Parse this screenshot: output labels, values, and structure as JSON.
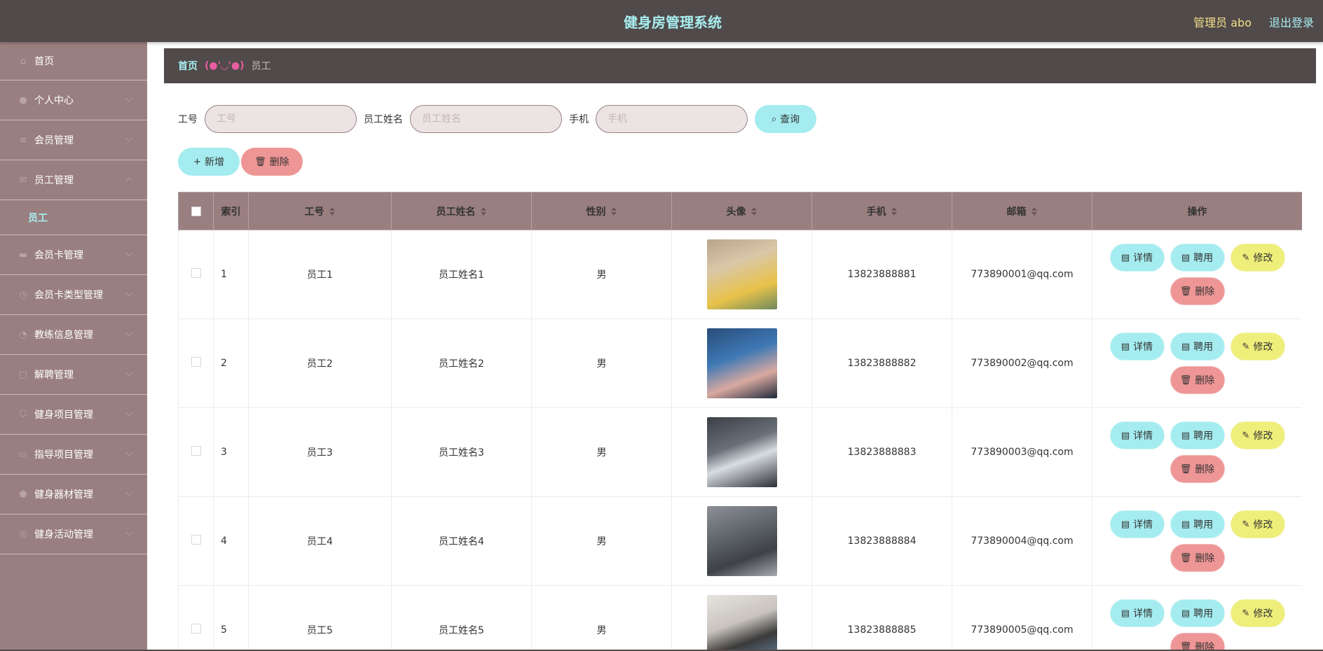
{
  "header": {
    "title": "健身房管理系统",
    "user_label": "管理员 abo",
    "logout_label": "退出登录"
  },
  "sidebar": {
    "items": [
      {
        "label": "首页",
        "icon": "home-icon"
      },
      {
        "label": "个人中心",
        "icon": "user-icon"
      },
      {
        "label": "会员管理",
        "icon": "list-icon"
      },
      {
        "label": "员工管理",
        "icon": "mail-icon",
        "expanded": true
      },
      {
        "label": "会员卡管理",
        "icon": "card-icon"
      },
      {
        "label": "会员卡类型管理",
        "icon": "clock-icon"
      },
      {
        "label": "教练信息管理",
        "icon": "time-icon"
      },
      {
        "label": "解聘管理",
        "icon": "file-icon"
      },
      {
        "label": "健身项目管理",
        "icon": "shield-icon"
      },
      {
        "label": "指导项目管理",
        "icon": "folder-icon"
      },
      {
        "label": "健身器材管理",
        "icon": "badge-icon"
      },
      {
        "label": "健身活动管理",
        "icon": "target-icon"
      }
    ],
    "submenu": {
      "label": "员工"
    }
  },
  "breadcrumb": {
    "home": "首页",
    "separator": "(●'◡'●)",
    "current": "员工"
  },
  "search": {
    "fields": [
      {
        "label": "工号",
        "placeholder": "工号"
      },
      {
        "label": "员工姓名",
        "placeholder": "员工姓名"
      },
      {
        "label": "手机",
        "placeholder": "手机"
      }
    ],
    "query_label": "查询"
  },
  "actions": {
    "add_label": "新增",
    "delete_label": "删除"
  },
  "table": {
    "headers": {
      "index": "索引",
      "employee_no": "工号",
      "name": "员工姓名",
      "gender": "性别",
      "avatar": "头像",
      "phone": "手机",
      "email": "邮箱",
      "ops": "操作"
    },
    "op_labels": {
      "detail": "详情",
      "hire": "聘用",
      "edit": "修改",
      "delete": "删除"
    },
    "rows": [
      {
        "index": "1",
        "employee_no": "员工1",
        "name": "员工姓名1",
        "gender": "男",
        "phone": "13823888881",
        "email": "773890001@qq.com"
      },
      {
        "index": "2",
        "employee_no": "员工2",
        "name": "员工姓名2",
        "gender": "男",
        "phone": "13823888882",
        "email": "773890002@qq.com"
      },
      {
        "index": "3",
        "employee_no": "员工3",
        "name": "员工姓名3",
        "gender": "男",
        "phone": "13823888883",
        "email": "773890003@qq.com"
      },
      {
        "index": "4",
        "employee_no": "员工4",
        "name": "员工姓名4",
        "gender": "男",
        "phone": "13823888884",
        "email": "773890004@qq.com"
      },
      {
        "index": "5",
        "employee_no": "员工5",
        "name": "员工姓名5",
        "gender": "男",
        "phone": "13823888885",
        "email": "773890005@qq.com"
      }
    ]
  },
  "colors": {
    "header_bg": "#514a4a",
    "sidebar_bg": "#9a7f80",
    "accent_cyan": "#a4ecef",
    "accent_red": "#ee9595",
    "accent_yellow": "#eeee7a",
    "title_color": "#a8eef0",
    "user_color": "#f2e08a"
  }
}
